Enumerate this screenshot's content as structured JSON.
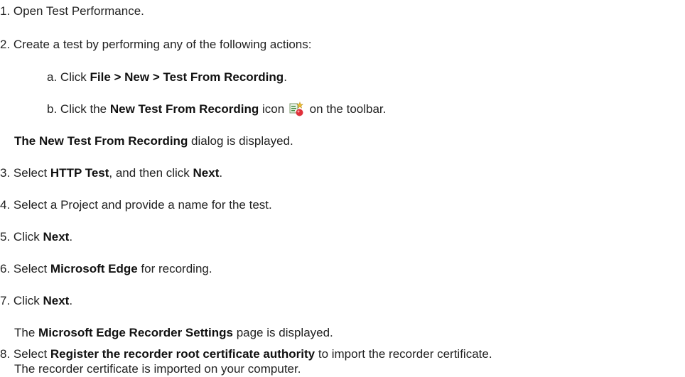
{
  "steps": {
    "s1": {
      "num": "1.",
      "text": "Open Test Performance."
    },
    "s2": {
      "num": "2.",
      "text": "Create a test by performing any of the following actions:"
    },
    "s2a": {
      "num": "a.",
      "pre": "Click ",
      "bold": "File > New > Test From Recording",
      "post": "."
    },
    "s2b": {
      "num": "b.",
      "pre": "Click the ",
      "bold": "New Test From Recording",
      "mid": " icon",
      "post": " on the toolbar."
    },
    "s2note": {
      "bold": "The New Test From Recording",
      "post": " dialog is displayed."
    },
    "s3": {
      "num": "3.",
      "pre": "Select ",
      "bold1": "HTTP Test",
      "mid": ", and then click ",
      "bold2": "Next",
      "post": "."
    },
    "s4": {
      "num": "4.",
      "text": "Select a Project and provide a name for the test."
    },
    "s5": {
      "num": "5.",
      "pre": "Click ",
      "bold": "Next",
      "post": "."
    },
    "s6": {
      "num": "6.",
      "pre": "Select ",
      "bold": "Microsoft Edge",
      "post": " for recording."
    },
    "s7": {
      "num": "7.",
      "pre": "Click ",
      "bold": "Next",
      "post": "."
    },
    "s7note": {
      "pre": "The ",
      "bold": "Microsoft Edge Recorder Settings",
      "post": " page is displayed."
    },
    "s8": {
      "num": "8.",
      "pre": "Select ",
      "bold": "Register the recorder root certificate authority",
      "post": " to import the recorder certificate."
    },
    "s8note": {
      "text": "The recorder certificate is imported on your computer."
    }
  },
  "icons": {
    "new_test_from_recording": "new-test-from-recording-icon"
  }
}
